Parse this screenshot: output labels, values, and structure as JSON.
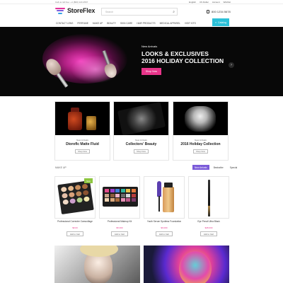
{
  "topbar": {
    "contact": "Call us toll free: +1 (800) 123-4567",
    "links": [
      "English",
      "US Dollar",
      "Account",
      "Wishlist"
    ]
  },
  "header": {
    "logo": "StoreFlex",
    "search_placeholder": "Search",
    "phone": "800 1234 5678"
  },
  "nav": {
    "items": [
      "Contact Lens",
      "Perfume",
      "Make Up",
      "Beauty",
      "Skin Care",
      "Hair Products",
      "Medical Apparel",
      "Visit Kits"
    ],
    "catalog_label": "Catalog"
  },
  "hero": {
    "kicker": "New Arrivals",
    "title_line1": "LOOKS & EXCLUSIVES",
    "title_line2": "2016 HOLIDAY COLLECTION",
    "cta": "Shop Now",
    "next_arrow": "›"
  },
  "categories": [
    {
      "kicker": "New Arrivals",
      "title": "Dioroflc Matte Fluid",
      "button": "Shop Now"
    },
    {
      "kicker": "New Arrivals",
      "title": "Collectors' Beauty",
      "button": "Shop Now"
    },
    {
      "kicker": "New Arrivals",
      "title": "2016 Holiday Collection",
      "button": "Shop Now"
    }
  ],
  "products_section": {
    "label": "Make Up",
    "tabs": [
      "New Arrivals",
      "Bestseller",
      "Special"
    ],
    "active_tab": "New Arrivals"
  },
  "products": [
    {
      "name": "Professional Correcter Camouflage",
      "price": "$9.00",
      "button": "Add to Cart",
      "badge": "New"
    },
    {
      "name": "Professional Makeup Kit",
      "price": "$5.000",
      "button": "Add to Cart",
      "badge": ""
    },
    {
      "name": "Youth Serum Spotless Foundation",
      "price": "$9.000",
      "button": "Add to Cart",
      "badge": ""
    },
    {
      "name": "Eye Pencil Ultra Black",
      "price": "$28.000",
      "button": "Add to Cart",
      "badge": ""
    }
  ],
  "colors": {
    "accent_pink": "#e8358a",
    "accent_purple": "#7b5bd9",
    "accent_cyan": "#2bc0d8",
    "badge_green": "#8dc63f"
  },
  "icons": [
    "search-icon",
    "phone-icon",
    "menu-icon",
    "chevron-right-icon"
  ]
}
